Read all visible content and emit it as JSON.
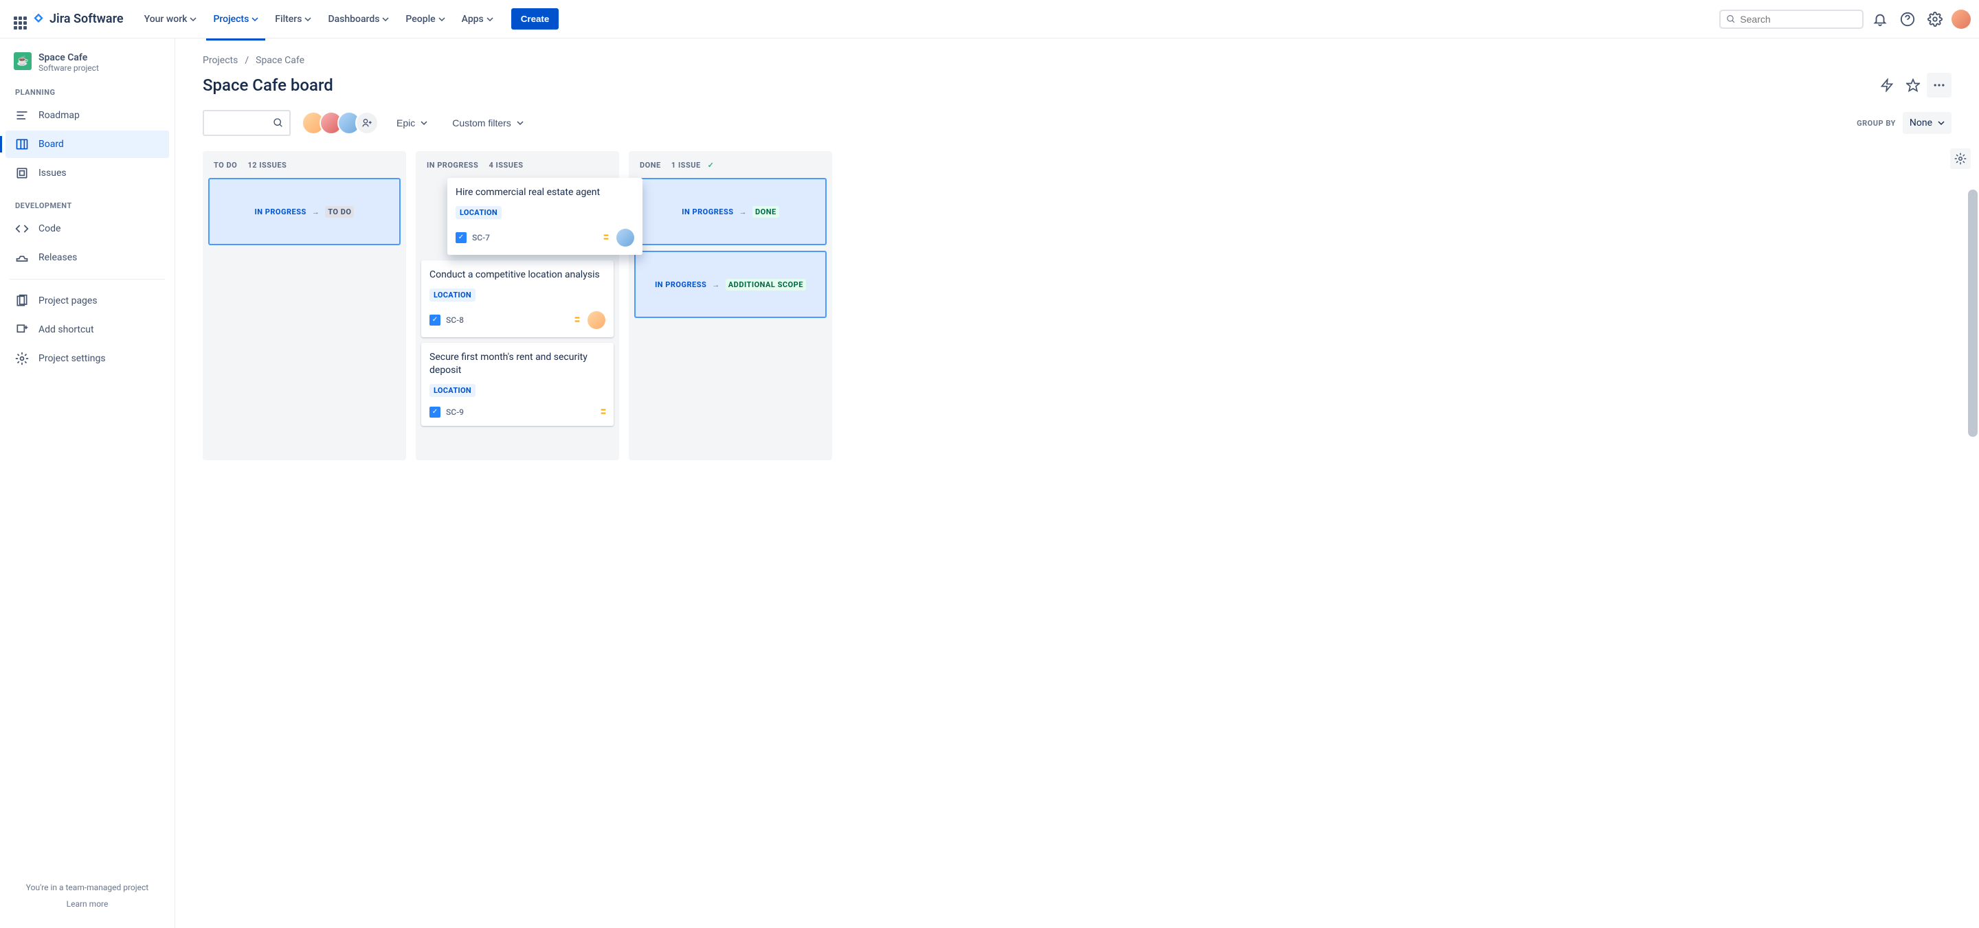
{
  "nav": {
    "logo": "Jira Software",
    "items": [
      "Your work",
      "Projects",
      "Filters",
      "Dashboards",
      "People",
      "Apps"
    ],
    "active_index": 1,
    "create": "Create",
    "search_placeholder": "Search"
  },
  "sidebar": {
    "project": {
      "name": "Space Cafe",
      "sub": "Software project"
    },
    "sections": {
      "planning": {
        "label": "PLANNING",
        "items": [
          "Roadmap",
          "Board",
          "Issues"
        ],
        "active_index": 1
      },
      "development": {
        "label": "DEVELOPMENT",
        "items": [
          "Code",
          "Releases"
        ]
      }
    },
    "footer_items": [
      "Project pages",
      "Add shortcut",
      "Project settings"
    ],
    "footnote": "You're in a team-managed project",
    "learn": "Learn more"
  },
  "breadcrumb": {
    "root": "Projects",
    "project": "Space Cafe"
  },
  "title": "Space Cafe board",
  "controls": {
    "epic": "Epic",
    "custom_filters": "Custom filters",
    "group_by_label": "GROUP BY",
    "group_by_value": "None"
  },
  "columns": [
    {
      "status": "TO DO",
      "count": "12 ISSUES",
      "transition_from": "IN PROGRESS",
      "transition_to": "TO DO",
      "to_style": "to-todo"
    },
    {
      "status": "IN PROGRESS",
      "count": "4 ISSUES"
    },
    {
      "status": "DONE",
      "count": "1 ISSUE",
      "check": true,
      "transitions": [
        {
          "from": "IN PROGRESS",
          "to": "DONE",
          "to_style": "to-done"
        },
        {
          "from": "IN PROGRESS",
          "to": "ADDITIONAL SCOPE",
          "to_style": "to-scope"
        }
      ]
    }
  ],
  "issues": [
    {
      "title": "Hire commercial real estate agent",
      "tag": "LOCATION",
      "key": "SC-7",
      "dragging": true,
      "avatar": "av3"
    },
    {
      "title": "Conduct a competitive location analysis",
      "tag": "LOCATION",
      "key": "SC-8",
      "avatar": "av1"
    },
    {
      "title": "Secure first month's rent and security deposit",
      "tag": "LOCATION",
      "key": "SC-9"
    }
  ]
}
